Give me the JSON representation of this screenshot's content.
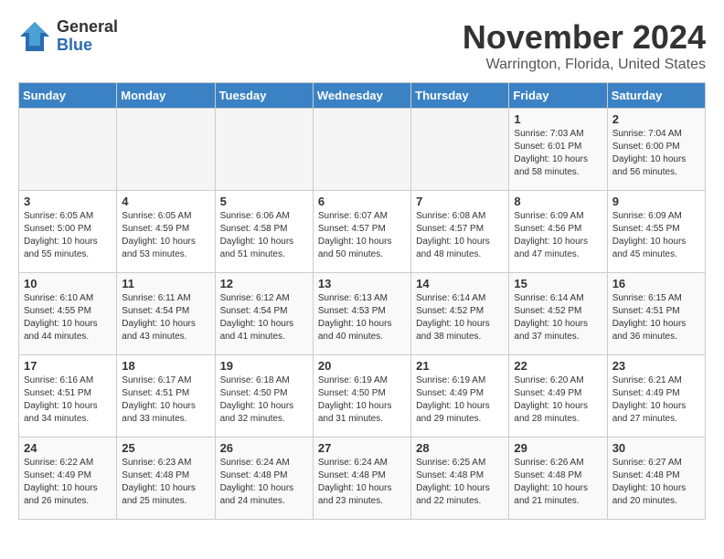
{
  "header": {
    "logo_line1": "General",
    "logo_line2": "Blue",
    "month": "November 2024",
    "location": "Warrington, Florida, United States"
  },
  "weekdays": [
    "Sunday",
    "Monday",
    "Tuesday",
    "Wednesday",
    "Thursday",
    "Friday",
    "Saturday"
  ],
  "weeks": [
    [
      {
        "day": "",
        "info": ""
      },
      {
        "day": "",
        "info": ""
      },
      {
        "day": "",
        "info": ""
      },
      {
        "day": "",
        "info": ""
      },
      {
        "day": "",
        "info": ""
      },
      {
        "day": "1",
        "info": "Sunrise: 7:03 AM\nSunset: 6:01 PM\nDaylight: 10 hours\nand 58 minutes."
      },
      {
        "day": "2",
        "info": "Sunrise: 7:04 AM\nSunset: 6:00 PM\nDaylight: 10 hours\nand 56 minutes."
      }
    ],
    [
      {
        "day": "3",
        "info": "Sunrise: 6:05 AM\nSunset: 5:00 PM\nDaylight: 10 hours\nand 55 minutes."
      },
      {
        "day": "4",
        "info": "Sunrise: 6:05 AM\nSunset: 4:59 PM\nDaylight: 10 hours\nand 53 minutes."
      },
      {
        "day": "5",
        "info": "Sunrise: 6:06 AM\nSunset: 4:58 PM\nDaylight: 10 hours\nand 51 minutes."
      },
      {
        "day": "6",
        "info": "Sunrise: 6:07 AM\nSunset: 4:57 PM\nDaylight: 10 hours\nand 50 minutes."
      },
      {
        "day": "7",
        "info": "Sunrise: 6:08 AM\nSunset: 4:57 PM\nDaylight: 10 hours\nand 48 minutes."
      },
      {
        "day": "8",
        "info": "Sunrise: 6:09 AM\nSunset: 4:56 PM\nDaylight: 10 hours\nand 47 minutes."
      },
      {
        "day": "9",
        "info": "Sunrise: 6:09 AM\nSunset: 4:55 PM\nDaylight: 10 hours\nand 45 minutes."
      }
    ],
    [
      {
        "day": "10",
        "info": "Sunrise: 6:10 AM\nSunset: 4:55 PM\nDaylight: 10 hours\nand 44 minutes."
      },
      {
        "day": "11",
        "info": "Sunrise: 6:11 AM\nSunset: 4:54 PM\nDaylight: 10 hours\nand 43 minutes."
      },
      {
        "day": "12",
        "info": "Sunrise: 6:12 AM\nSunset: 4:54 PM\nDaylight: 10 hours\nand 41 minutes."
      },
      {
        "day": "13",
        "info": "Sunrise: 6:13 AM\nSunset: 4:53 PM\nDaylight: 10 hours\nand 40 minutes."
      },
      {
        "day": "14",
        "info": "Sunrise: 6:14 AM\nSunset: 4:52 PM\nDaylight: 10 hours\nand 38 minutes."
      },
      {
        "day": "15",
        "info": "Sunrise: 6:14 AM\nSunset: 4:52 PM\nDaylight: 10 hours\nand 37 minutes."
      },
      {
        "day": "16",
        "info": "Sunrise: 6:15 AM\nSunset: 4:51 PM\nDaylight: 10 hours\nand 36 minutes."
      }
    ],
    [
      {
        "day": "17",
        "info": "Sunrise: 6:16 AM\nSunset: 4:51 PM\nDaylight: 10 hours\nand 34 minutes."
      },
      {
        "day": "18",
        "info": "Sunrise: 6:17 AM\nSunset: 4:51 PM\nDaylight: 10 hours\nand 33 minutes."
      },
      {
        "day": "19",
        "info": "Sunrise: 6:18 AM\nSunset: 4:50 PM\nDaylight: 10 hours\nand 32 minutes."
      },
      {
        "day": "20",
        "info": "Sunrise: 6:19 AM\nSunset: 4:50 PM\nDaylight: 10 hours\nand 31 minutes."
      },
      {
        "day": "21",
        "info": "Sunrise: 6:19 AM\nSunset: 4:49 PM\nDaylight: 10 hours\nand 29 minutes."
      },
      {
        "day": "22",
        "info": "Sunrise: 6:20 AM\nSunset: 4:49 PM\nDaylight: 10 hours\nand 28 minutes."
      },
      {
        "day": "23",
        "info": "Sunrise: 6:21 AM\nSunset: 4:49 PM\nDaylight: 10 hours\nand 27 minutes."
      }
    ],
    [
      {
        "day": "24",
        "info": "Sunrise: 6:22 AM\nSunset: 4:49 PM\nDaylight: 10 hours\nand 26 minutes."
      },
      {
        "day": "25",
        "info": "Sunrise: 6:23 AM\nSunset: 4:48 PM\nDaylight: 10 hours\nand 25 minutes."
      },
      {
        "day": "26",
        "info": "Sunrise: 6:24 AM\nSunset: 4:48 PM\nDaylight: 10 hours\nand 24 minutes."
      },
      {
        "day": "27",
        "info": "Sunrise: 6:24 AM\nSunset: 4:48 PM\nDaylight: 10 hours\nand 23 minutes."
      },
      {
        "day": "28",
        "info": "Sunrise: 6:25 AM\nSunset: 4:48 PM\nDaylight: 10 hours\nand 22 minutes."
      },
      {
        "day": "29",
        "info": "Sunrise: 6:26 AM\nSunset: 4:48 PM\nDaylight: 10 hours\nand 21 minutes."
      },
      {
        "day": "30",
        "info": "Sunrise: 6:27 AM\nSunset: 4:48 PM\nDaylight: 10 hours\nand 20 minutes."
      }
    ]
  ]
}
